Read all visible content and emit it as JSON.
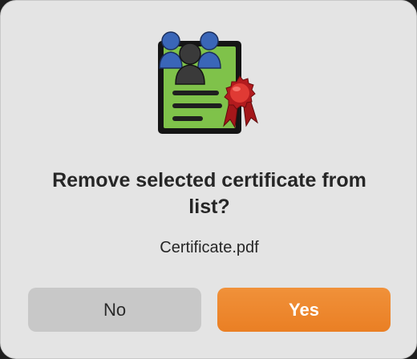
{
  "dialog": {
    "icon": "certificate-award-icon",
    "title": "Remove selected certificate from list?",
    "filename": "Certificate.pdf",
    "buttons": {
      "no_label": "No",
      "yes_label": "Yes"
    }
  },
  "colors": {
    "dialog_background": "#e4e4e4",
    "primary_button": "#ee8a30",
    "secondary_button": "#c8c8c8",
    "certificate_green": "#7fc24a",
    "people_blue": "#3a66b8",
    "ribbon_red": "#d0282a"
  }
}
